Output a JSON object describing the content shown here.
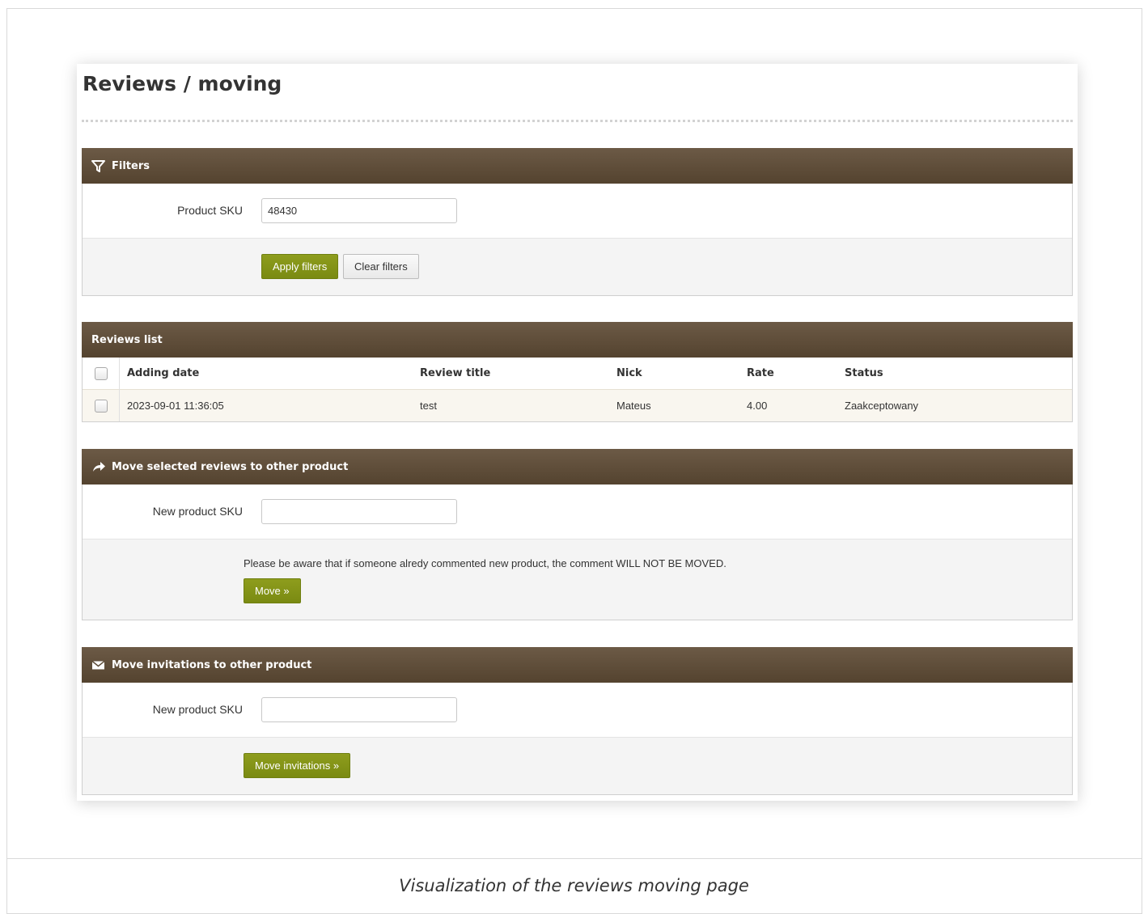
{
  "page": {
    "title": "Reviews / moving",
    "caption": "Visualization of the reviews moving page"
  },
  "filters": {
    "header": "Filters",
    "icon": "filter-icon",
    "sku_label": "Product SKU",
    "sku_value": "48430",
    "apply_label": "Apply filters",
    "clear_label": "Clear filters"
  },
  "reviews_list": {
    "header": "Reviews list",
    "columns": [
      "Adding date",
      "Review title",
      "Nick",
      "Rate",
      "Status"
    ],
    "rows": [
      {
        "date": "2023-09-01 11:36:05",
        "title": "test",
        "nick": "Mateus",
        "rate": "4.00",
        "status": "Zaakceptowany"
      }
    ]
  },
  "move_reviews": {
    "header": "Move selected reviews to other product",
    "icon": "share-arrow-icon",
    "sku_label": "New product SKU",
    "sku_value": "",
    "warning": "Please be aware that if someone alredy commented new product, the comment WILL NOT BE MOVED.",
    "button_label": "Move »"
  },
  "move_invitations": {
    "header": "Move invitations to other product",
    "icon": "envelope-icon",
    "sku_label": "New product SKU",
    "sku_value": "",
    "button_label": "Move invitations »"
  },
  "colors": {
    "header_bg": "#5f4e3a",
    "button_green": "#849415",
    "row_highlight": "#f9f6ef"
  }
}
